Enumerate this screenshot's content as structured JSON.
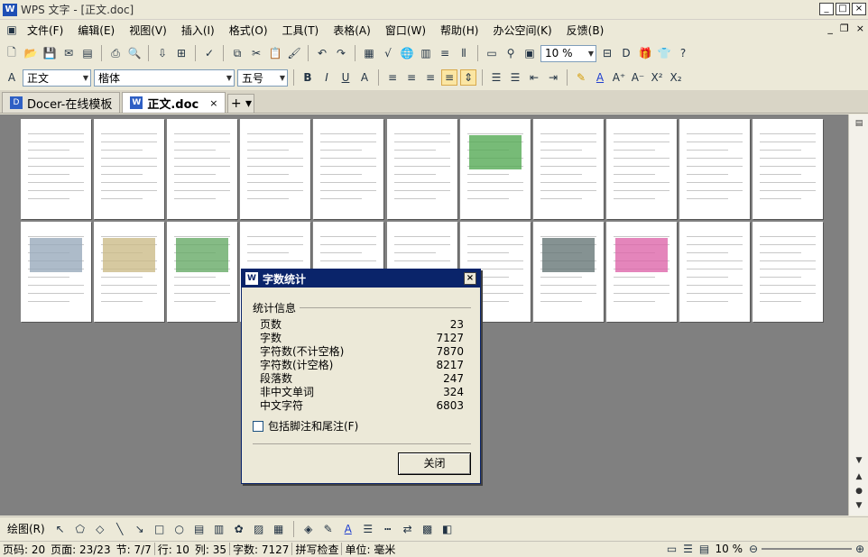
{
  "window": {
    "title": "WPS 文字 - [正文.doc]",
    "min": "_",
    "max": "□",
    "close": "×"
  },
  "menu": {
    "items": [
      "文件(F)",
      "编辑(E)",
      "视图(V)",
      "插入(I)",
      "格式(O)",
      "工具(T)",
      "表格(A)",
      "窗口(W)",
      "帮助(H)",
      "办公空间(K)",
      "反馈(B)"
    ],
    "mdi_min": "_",
    "mdi_restore": "❐",
    "mdi_close": "×"
  },
  "toolbar": {
    "zoom": "10 %"
  },
  "format_bar": {
    "style": "正文",
    "font": "楷体",
    "size": "五号"
  },
  "tabs": [
    {
      "label": "Docer-在线模板",
      "icon": "D"
    },
    {
      "label": "正文.doc",
      "icon": "W",
      "close": "×"
    }
  ],
  "new_tab": "+ ▾",
  "dialog": {
    "title": "字数统计",
    "group_label": "统计信息",
    "stats": [
      {
        "label": "页数",
        "value": "23"
      },
      {
        "label": "字数",
        "value": "7127"
      },
      {
        "label": "字符数(不计空格)",
        "value": "7870"
      },
      {
        "label": "字符数(计空格)",
        "value": "8217"
      },
      {
        "label": "段落数",
        "value": "247"
      },
      {
        "label": "非中文单词",
        "value": "324"
      },
      {
        "label": "中文字符",
        "value": "6803"
      }
    ],
    "checkbox_label": "包括脚注和尾注(F)",
    "close_button": "关闭"
  },
  "drawbar": {
    "label": "绘图(R)"
  },
  "status": {
    "page_code": "页码: 20",
    "page": "页面: 23/23",
    "section": "节: 7/7",
    "line": "行: 10",
    "column": "列: 35",
    "words": "字数: 7127",
    "spell": "拼写检查",
    "unit": "单位: 毫米",
    "zoom": "10 %"
  }
}
